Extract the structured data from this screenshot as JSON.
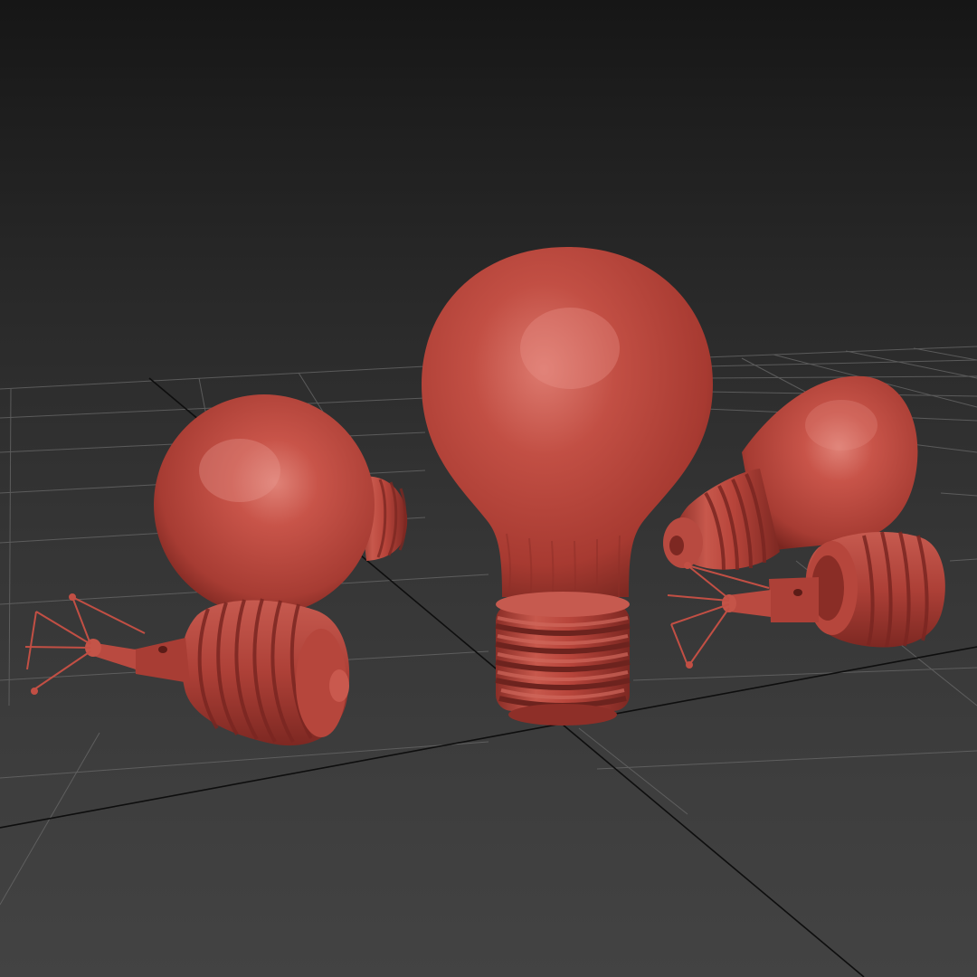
{
  "viewport": {
    "background_top": "#161616",
    "background_bottom": "#434343",
    "grid_color": "#6a6a6a",
    "grid_axis_color": "#0d0d0d"
  },
  "model": {
    "material_color": "#b8453b",
    "highlight_color": "#e07b70",
    "shadow_color": "#5c1c17",
    "objects": [
      {
        "name": "bulb-large-upright"
      },
      {
        "name": "bulb-glass-left"
      },
      {
        "name": "bulb-socket-left"
      },
      {
        "name": "filament-left"
      },
      {
        "name": "bulb-glass-right"
      },
      {
        "name": "bulb-socket-right"
      },
      {
        "name": "filament-right"
      }
    ]
  }
}
